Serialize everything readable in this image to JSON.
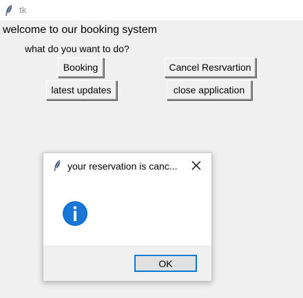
{
  "window": {
    "title": "tk"
  },
  "main": {
    "welcome_text": "welcome to our booking system",
    "prompt_text": "what do you want to do?",
    "buttons": {
      "booking": "Booking",
      "cancel_reservation": "Cancel Resrvartion",
      "latest_updates": "latest updates",
      "close_application": "close application"
    }
  },
  "dialog": {
    "title": "your reservation is canc...",
    "icon": "info-icon",
    "ok_label": "OK",
    "accent_color": "#0078d7"
  }
}
